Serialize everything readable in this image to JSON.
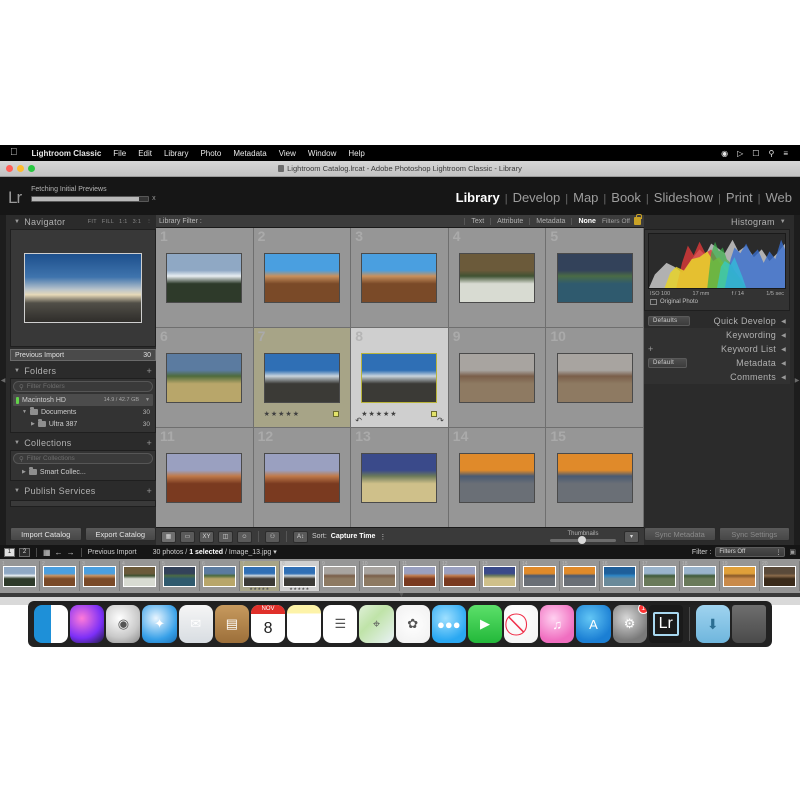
{
  "menubar": {
    "apple_icon": "apple-icon",
    "app_name": "Lightroom Classic",
    "items": [
      "File",
      "Edit",
      "Library",
      "Photo",
      "Metadata",
      "View",
      "Window",
      "Help"
    ],
    "right_icons": [
      "notification-icon",
      "siri-icon",
      "screen-mirroring-icon",
      "search-icon",
      "control-center-icon"
    ]
  },
  "window": {
    "title": "Lightroom Catalog.lrcat - Adobe Photoshop Lightroom Classic - Library",
    "doc_icon": "document-icon"
  },
  "topbar": {
    "logo": "Lr",
    "activity_label": "Fetching Initial Previews",
    "progress_percent": 92,
    "cancel_label": "x",
    "modules": [
      {
        "label": "Library",
        "active": true
      },
      {
        "label": "Develop",
        "active": false
      },
      {
        "label": "Map",
        "active": false
      },
      {
        "label": "Book",
        "active": false
      },
      {
        "label": "Slideshow",
        "active": false
      },
      {
        "label": "Print",
        "active": false
      },
      {
        "label": "Web",
        "active": false
      }
    ]
  },
  "left_panel": {
    "navigator": {
      "title": "Navigator",
      "zoom_options": [
        "FIT",
        "FILL",
        "1:1",
        "3:1"
      ],
      "chevron": "chevron-down-icon"
    },
    "source": {
      "label": "Previous Import",
      "count": "30"
    },
    "folders": {
      "title": "Folders",
      "filter_placeholder": "Filter Folders",
      "volume": {
        "name": "Macintosh HD",
        "space": "14.9 / 42.7 GB"
      },
      "rows": [
        {
          "label": "Documents",
          "count": "30",
          "depth": 1
        },
        {
          "label": "Ultra 387",
          "count": "30",
          "depth": 2
        }
      ]
    },
    "collections": {
      "title": "Collections",
      "filter_placeholder": "Filter Collections",
      "rows": [
        {
          "label": "Smart Collec...",
          "count": ""
        }
      ]
    },
    "publish_services": {
      "title": "Publish Services"
    },
    "buttons": {
      "import": "Import Catalog",
      "export": "Export Catalog"
    }
  },
  "library_filter": {
    "title": "Library Filter :",
    "tabs": [
      {
        "label": "Text",
        "active": false
      },
      {
        "label": "Attribute",
        "active": false
      },
      {
        "label": "Metadata",
        "active": false
      },
      {
        "label": "None",
        "active": true
      }
    ],
    "filters_state": "Filters Off",
    "lock_icon": "lock-icon"
  },
  "grid": {
    "cells": [
      {
        "index": "1",
        "state": "normal",
        "stars": "",
        "c1": "#8fa8c4",
        "c2": "#e8eef2",
        "c3": "#2e3a2a"
      },
      {
        "index": "2",
        "state": "normal",
        "stars": "",
        "c1": "#4a9fe0",
        "c2": "#c9915e",
        "c3": "#7a4a28"
      },
      {
        "index": "3",
        "state": "normal",
        "stars": "",
        "c1": "#4a9fe0",
        "c2": "#c9915e",
        "c3": "#7a4a28"
      },
      {
        "index": "4",
        "state": "normal",
        "stars": "",
        "c1": "#6b5a3a",
        "c2": "#3f5232",
        "c3": "#d8dbd2"
      },
      {
        "index": "5",
        "state": "normal",
        "stars": "",
        "c1": "#33425a",
        "c2": "#4a6b45",
        "c3": "#2f5a6e"
      },
      {
        "index": "6",
        "state": "normal",
        "stars": "",
        "c1": "#5b7ba0",
        "c2": "#4e6b3c",
        "c3": "#b8a66a"
      },
      {
        "index": "7",
        "state": "selected",
        "stars": "★★★★★",
        "c1": "#2f6fb5",
        "c2": "#c9d4dd",
        "c3": "#3b3a36"
      },
      {
        "index": "8",
        "state": "active",
        "stars": "★★★★★",
        "c1": "#2f6fb5",
        "c2": "#c9d4dd",
        "c3": "#3b3a36"
      },
      {
        "index": "9",
        "state": "normal",
        "stars": "",
        "c1": "#a8a4a0",
        "c2": "#7a5f4a",
        "c3": "#8e7a62"
      },
      {
        "index": "10",
        "state": "normal",
        "stars": "",
        "c1": "#a8a4a0",
        "c2": "#7a5f4a",
        "c3": "#8e7a62"
      },
      {
        "index": "11",
        "state": "normal",
        "stars": "",
        "c1": "#9aa0c0",
        "c2": "#c07a4a",
        "c3": "#7a3a20"
      },
      {
        "index": "12",
        "state": "normal",
        "stars": "",
        "c1": "#9aa0c0",
        "c2": "#c07a4a",
        "c3": "#7a3a20"
      },
      {
        "index": "13",
        "state": "normal",
        "stars": "",
        "c1": "#3a4a8a",
        "c2": "#6b7a5a",
        "c3": "#cfc08a"
      },
      {
        "index": "14",
        "state": "normal",
        "stars": "",
        "c1": "#e08a2a",
        "c2": "#4a5a72",
        "c3": "#6a6f76"
      },
      {
        "index": "15",
        "state": "normal",
        "stars": "",
        "c1": "#e08a2a",
        "c2": "#4a5a72",
        "c3": "#6a6f76"
      }
    ],
    "badge_icon": "color-label-badge"
  },
  "toolbar": {
    "view_icons": [
      "grid-view-icon",
      "loupe-view-icon",
      "compare-view-icon",
      "survey-view-icon",
      "people-view-icon"
    ],
    "painter_icon": "spray-can-icon",
    "sort_icon": "sort-az-icon",
    "sort_label": "Sort:",
    "sort_value": "Capture Time",
    "thumbnails_label": "Thumbnails",
    "thumbnail_size": 45
  },
  "right_panel": {
    "histogram": {
      "title": "Histogram",
      "chevron": "chevron-down-icon",
      "iso": "ISO 100",
      "focal": "17 mm",
      "aperture": "f / 14",
      "shutter": "1/5 sec",
      "original_photo": "Original Photo"
    },
    "sections": [
      {
        "title": "Quick Develop",
        "preset": "Defaults"
      },
      {
        "title": "Keywording",
        "preset": ""
      },
      {
        "title": "Keyword List",
        "preset": ""
      },
      {
        "title": "Metadata",
        "preset": "Default"
      },
      {
        "title": "Comments",
        "preset": ""
      }
    ],
    "buttons": {
      "sync_metadata": "Sync Metadata",
      "sync_settings": "Sync Settings"
    }
  },
  "filmstrip": {
    "page_tabs": [
      "1",
      "2"
    ],
    "grid_icon": "grid-icon",
    "back_icon": "arrow-left-icon",
    "forward_icon": "arrow-right-icon",
    "source": "Previous Import",
    "status_count": "30 photos",
    "status_selected": "1 selected",
    "status_file": "Image_13.jpg",
    "filter_label": "Filter :",
    "filter_value": "Filters Off",
    "cells": [
      {
        "index": "1",
        "state": "normal",
        "stars": "",
        "c1": "#8fa8c4",
        "c2": "#e8eef2",
        "c3": "#2e3a2a"
      },
      {
        "index": "2",
        "state": "normal",
        "stars": "",
        "c1": "#4a9fe0",
        "c2": "#c9915e",
        "c3": "#7a4a28"
      },
      {
        "index": "3",
        "state": "normal",
        "stars": "",
        "c1": "#4a9fe0",
        "c2": "#c9915e",
        "c3": "#7a4a28"
      },
      {
        "index": "4",
        "state": "normal",
        "stars": "",
        "c1": "#6b5a3a",
        "c2": "#3f5232",
        "c3": "#d8dbd2"
      },
      {
        "index": "5",
        "state": "normal",
        "stars": "",
        "c1": "#33425a",
        "c2": "#4a6b45",
        "c3": "#2f5a6e"
      },
      {
        "index": "6",
        "state": "normal",
        "stars": "",
        "c1": "#5b7ba0",
        "c2": "#4e6b3c",
        "c3": "#b8a66a"
      },
      {
        "index": "7",
        "state": "selected",
        "stars": "★★★★★",
        "c1": "#2f6fb5",
        "c2": "#c9d4dd",
        "c3": "#3b3a36"
      },
      {
        "index": "8",
        "state": "active",
        "stars": "★★★★★",
        "c1": "#2f6fb5",
        "c2": "#c9d4dd",
        "c3": "#3b3a36"
      },
      {
        "index": "9",
        "state": "normal",
        "stars": "",
        "c1": "#a8a4a0",
        "c2": "#7a5f4a",
        "c3": "#8e7a62"
      },
      {
        "index": "10",
        "state": "normal",
        "stars": "",
        "c1": "#a8a4a0",
        "c2": "#7a5f4a",
        "c3": "#8e7a62"
      },
      {
        "index": "11",
        "state": "normal",
        "stars": "",
        "c1": "#9aa0c0",
        "c2": "#c07a4a",
        "c3": "#7a3a20"
      },
      {
        "index": "12",
        "state": "normal",
        "stars": "",
        "c1": "#9aa0c0",
        "c2": "#c07a4a",
        "c3": "#7a3a20"
      },
      {
        "index": "13",
        "state": "normal",
        "stars": "",
        "c1": "#3a4a8a",
        "c2": "#6b7a5a",
        "c3": "#cfc08a"
      },
      {
        "index": "14",
        "state": "normal",
        "stars": "",
        "c1": "#e08a2a",
        "c2": "#4a5a72",
        "c3": "#6a6f76"
      },
      {
        "index": "15",
        "state": "normal",
        "stars": "",
        "c1": "#e08a2a",
        "c2": "#4a5a72",
        "c3": "#6a6f76"
      },
      {
        "index": "16",
        "state": "normal",
        "stars": "",
        "c1": "#1f5f9a",
        "c2": "#2f86c4",
        "c3": "#6a8a9a"
      },
      {
        "index": "17",
        "state": "normal",
        "stars": "",
        "c1": "#9ab4cc",
        "c2": "#3f5a3a",
        "c3": "#6a7a5a"
      },
      {
        "index": "18",
        "state": "normal",
        "stars": "",
        "c1": "#9ab4cc",
        "c2": "#3f5a3a",
        "c3": "#6a7a5a"
      },
      {
        "index": "19",
        "state": "normal",
        "stars": "",
        "c1": "#e0a03a",
        "c2": "#8a5a2a",
        "c3": "#c98a4a"
      },
      {
        "index": "20",
        "state": "normal",
        "stars": "",
        "c1": "#5a4a3a",
        "c2": "#8a6a4a",
        "c3": "#3a2a1a"
      }
    ]
  },
  "dock": {
    "items": [
      {
        "name": "finder-icon",
        "label": "Finder",
        "running": true
      },
      {
        "name": "siri-icon",
        "label": "Siri",
        "running": false
      },
      {
        "name": "launchpad-icon",
        "label": "Launchpad",
        "running": false
      },
      {
        "name": "safari-icon",
        "label": "Safari",
        "running": false
      },
      {
        "name": "mail-icon",
        "label": "Mail",
        "running": false
      },
      {
        "name": "contacts-icon",
        "label": "Contacts",
        "running": false
      },
      {
        "name": "calendar-icon",
        "label": "Calendar",
        "running": false
      },
      {
        "name": "notes-icon",
        "label": "Notes",
        "running": false
      },
      {
        "name": "reminders-icon",
        "label": "Reminders",
        "running": false
      },
      {
        "name": "maps-icon",
        "label": "Maps",
        "running": false
      },
      {
        "name": "photos-icon",
        "label": "Photos",
        "running": false
      },
      {
        "name": "messages-icon",
        "label": "Messages",
        "running": false
      },
      {
        "name": "facetime-icon",
        "label": "FaceTime",
        "running": false
      },
      {
        "name": "news-icon",
        "label": "News",
        "running": false
      },
      {
        "name": "music-icon",
        "label": "Music",
        "running": false
      },
      {
        "name": "appstore-icon",
        "label": "App Store",
        "running": false
      },
      {
        "name": "system-preferences-icon",
        "label": "System Preferences",
        "running": false,
        "badge": "1"
      },
      {
        "name": "lightroom-icon",
        "label": "Lr",
        "running": true
      }
    ],
    "calendar_month": "NOV",
    "calendar_day": "8",
    "downloads_label": "Downloads",
    "trash_label": "Trash"
  }
}
